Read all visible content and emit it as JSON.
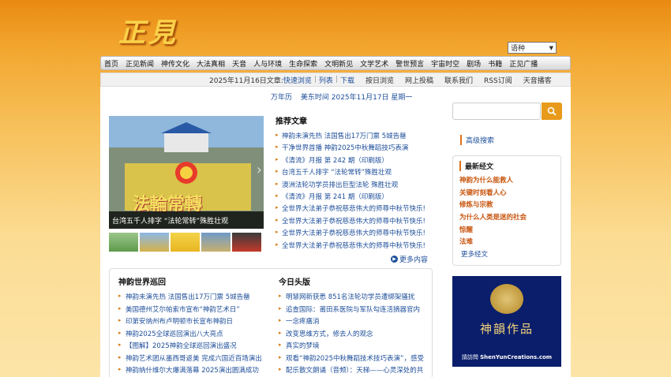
{
  "logo": "正見",
  "lang_select": "语种",
  "nav": [
    "首页",
    "正见新闻",
    "神传文化",
    "大法真相",
    "天音",
    "人与环境",
    "生命探索",
    "文明新见",
    "文学艺术",
    "警世预言",
    "宇宙时空",
    "剧场",
    "书籍",
    "正见广播"
  ],
  "sub": {
    "date_prefix": "2025年11月16日文章:",
    "quick": "快速浏览",
    "list": "列表",
    "download": "下载",
    "items": [
      "按日浏览",
      "网上投稿",
      "联系我们",
      "RSS订阅",
      "天音播客"
    ]
  },
  "dates": {
    "wanniansli": "万年历",
    "us_time": "美东时间 2025年11月17日 星期一"
  },
  "slide": {
    "caption": "台湾五千人排字 “法轮常转”殊胜壮观",
    "overlay": "法輪常轉"
  },
  "recommended": {
    "title": "推荐文章",
    "items": [
      "神韵未演先热 法国售出17万门票 5城告罄",
      "干净世界首播 神韵2025中秋舞蹈技巧表演",
      "《清流》月报 第 242 期（印刷版）",
      "台湾五千人排字 “法轮常转”殊胜壮观",
      "澳洲法轮功学员排出巨型法轮 殊胜壮观",
      "《清流》月报 第 241 期（印刷版）",
      "全世界大法弟子恭祝慈悲伟大的师尊中秋节快乐!",
      "全世界大法弟子恭祝慈悲伟大的师尊中秋节快乐!",
      "全世界大法弟子恭祝慈悲伟大的师尊中秋节快乐!",
      "全世界大法弟子恭祝慈悲伟大的师尊中秋节快乐!"
    ],
    "more": "更多内容"
  },
  "tour": {
    "title": "神韵世界巡回",
    "items": [
      "神韵未演先热 法国售出17万门票 5城告罄",
      "美国德州艾尔帕索市宣布“神韵艺术日”",
      "印第安纳州布卢明顿市长宣布神韵日",
      "神韵2025全球巡回演出八大亮点",
      "【图解】2025神韵全球巡回演出盛况",
      "神韵艺术团从墨西哥返美 完成六国近百场演出",
      "神韵纳什维尔大爆满落幕 2025演出圆满成功"
    ]
  },
  "headlines": {
    "title": "今日头版",
    "items": [
      "明慧网新获悉 851名法轮功学员遭绑架骚扰",
      "追查国际：莆田系医院与军队勾连活摘器官内",
      "一念疼痛消",
      "改变思维方式，修去人的观念",
      "真实的梦境",
      "观看“神韵2025中秋舞蹈技术技巧表演”，感受",
      "配乐散文朗诵（音频）：天梯——心灵深处的共"
    ]
  },
  "search": {
    "placeholder": "",
    "advanced": "高级搜索"
  },
  "latest": {
    "title": "最新经文",
    "items": [
      "神韵为什么能救人",
      "关键时刻看人心",
      "修炼与宗教",
      "为什么人类是迷的社会",
      "惊醒",
      "法难"
    ],
    "more": "更多经文"
  },
  "banner": {
    "title": "神韻作品",
    "url": "ShenYunCreations.com",
    "small": "請訪問"
  }
}
